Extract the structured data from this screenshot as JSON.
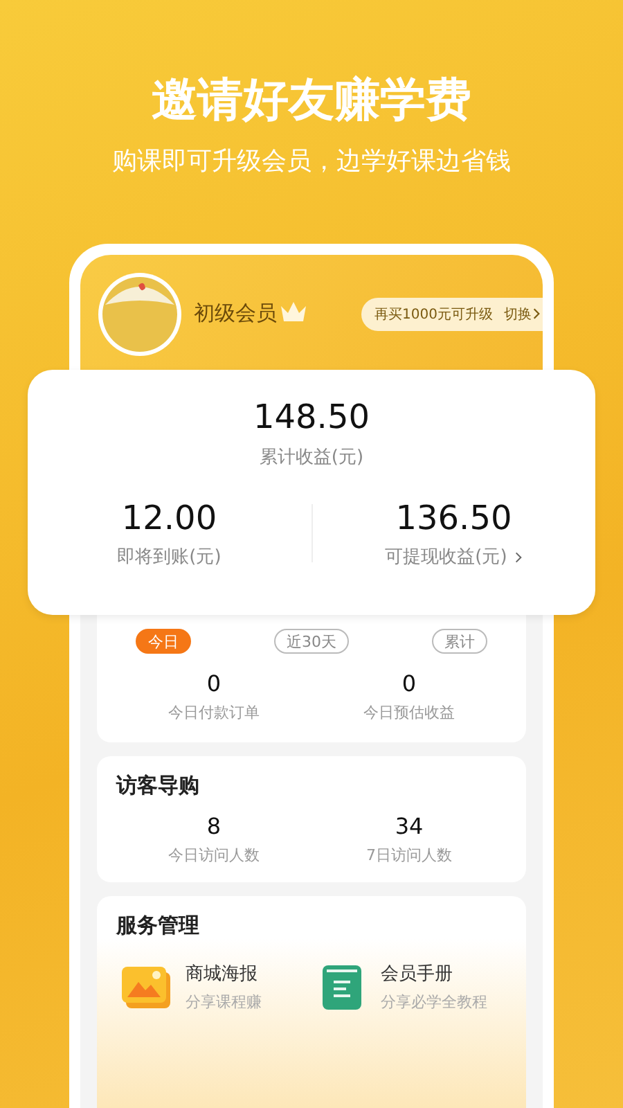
{
  "headline": "邀请好友赚学费",
  "subheadline": "购课即可升级会员，边学好课边省钱",
  "member": {
    "level": "初级会员",
    "upgrade_hint": "再买1000元可升级",
    "switch": "切换"
  },
  "earnings": {
    "total": "148.50",
    "total_label": "累计收益(元)",
    "pending": "12.00",
    "pending_label": "即将到账(元)",
    "withdrawable": "136.50",
    "withdrawable_label": "可提现收益(元)"
  },
  "period_tabs": [
    {
      "label": "今日",
      "selected": true
    },
    {
      "label": "近30天",
      "selected": false
    },
    {
      "label": "累计",
      "selected": false
    }
  ],
  "today_stats": [
    {
      "value": "0",
      "label": "今日付款订单"
    },
    {
      "value": "0",
      "label": "今日预估收益"
    }
  ],
  "visitors": {
    "title": "访客导购",
    "stats": [
      {
        "value": "8",
        "label": "今日访问人数"
      },
      {
        "value": "34",
        "label": "7日访问人数"
      }
    ]
  },
  "services": {
    "title": "服务管理",
    "items": [
      {
        "kind": "poster",
        "title": "商城海报",
        "subtitle": "分享课程赚"
      },
      {
        "kind": "handbook",
        "title": "会员手册",
        "subtitle": "分享必学全教程"
      }
    ]
  }
}
